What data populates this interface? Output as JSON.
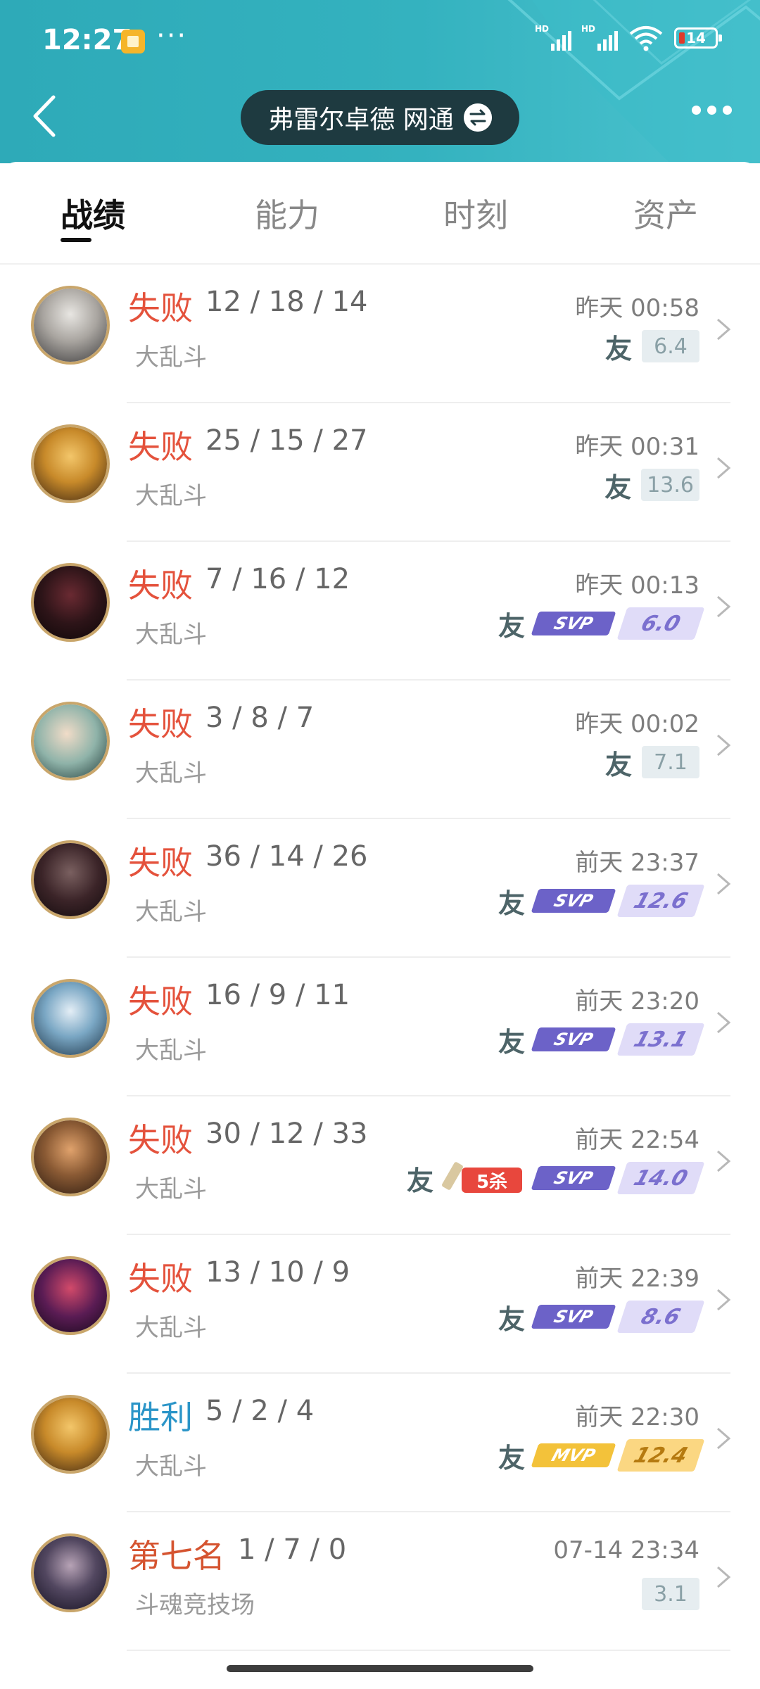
{
  "status_bar": {
    "time": "12:27",
    "more": "···",
    "hd1": "HD",
    "hd2": "HD",
    "battery": "14"
  },
  "header": {
    "server_name": "弗雷尔卓德 网通"
  },
  "tabs": [
    "战绩",
    "能力",
    "时刻",
    "资产"
  ],
  "matches": [
    {
      "result": "失败",
      "kda": "12 / 18 / 14",
      "mode": "大乱斗",
      "time": "昨天 00:58",
      "score": "6.4",
      "friend": "友"
    },
    {
      "result": "失败",
      "kda": "25 / 15 / 27",
      "mode": "大乱斗",
      "time": "昨天 00:31",
      "score": "13.6",
      "friend": "友"
    },
    {
      "result": "失败",
      "kda": "7 / 16 / 12",
      "mode": "大乱斗",
      "time": "昨天 00:13",
      "score": "6.0",
      "friend": "友",
      "badge": "SVP"
    },
    {
      "result": "失败",
      "kda": "3 / 8 / 7",
      "mode": "大乱斗",
      "time": "昨天 00:02",
      "score": "7.1",
      "friend": "友"
    },
    {
      "result": "失败",
      "kda": "36 / 14 / 26",
      "mode": "大乱斗",
      "time": "前天 23:37",
      "score": "12.6",
      "friend": "友",
      "badge": "SVP"
    },
    {
      "result": "失败",
      "kda": "16 / 9 / 11",
      "mode": "大乱斗",
      "time": "前天 23:20",
      "score": "13.1",
      "friend": "友",
      "badge": "SVP"
    },
    {
      "result": "失败",
      "kda": "30 / 12 / 33",
      "mode": "大乱斗",
      "time": "前天 22:54",
      "score": "14.0",
      "friend": "友",
      "badge": "SVP",
      "penta": "5杀"
    },
    {
      "result": "失败",
      "kda": "13 / 10 / 9",
      "mode": "大乱斗",
      "time": "前天 22:39",
      "score": "8.6",
      "friend": "友",
      "badge": "SVP"
    },
    {
      "result": "胜利",
      "kda": "5 / 2 / 4",
      "mode": "大乱斗",
      "time": "前天 22:30",
      "score": "12.4",
      "friend": "友",
      "badge": "MVP"
    },
    {
      "result": "第七名",
      "kda": "1 / 7 / 0",
      "mode": "斗魂竞技场",
      "time": "07-14 23:34",
      "score": "3.1"
    }
  ],
  "colors": {
    "header_bg": "#34b2bf",
    "loss": "#e4523c",
    "win": "#2b95c8",
    "svp": "#6c62c8",
    "mvp": "#f3c23a"
  },
  "icons": [
    "back-arrow-icon",
    "swap-icon",
    "more-dots-icon",
    "friend-icon",
    "svp-badge-icon",
    "mvp-badge-icon",
    "pentakill-badge-icon",
    "chevron-right-icon"
  ]
}
